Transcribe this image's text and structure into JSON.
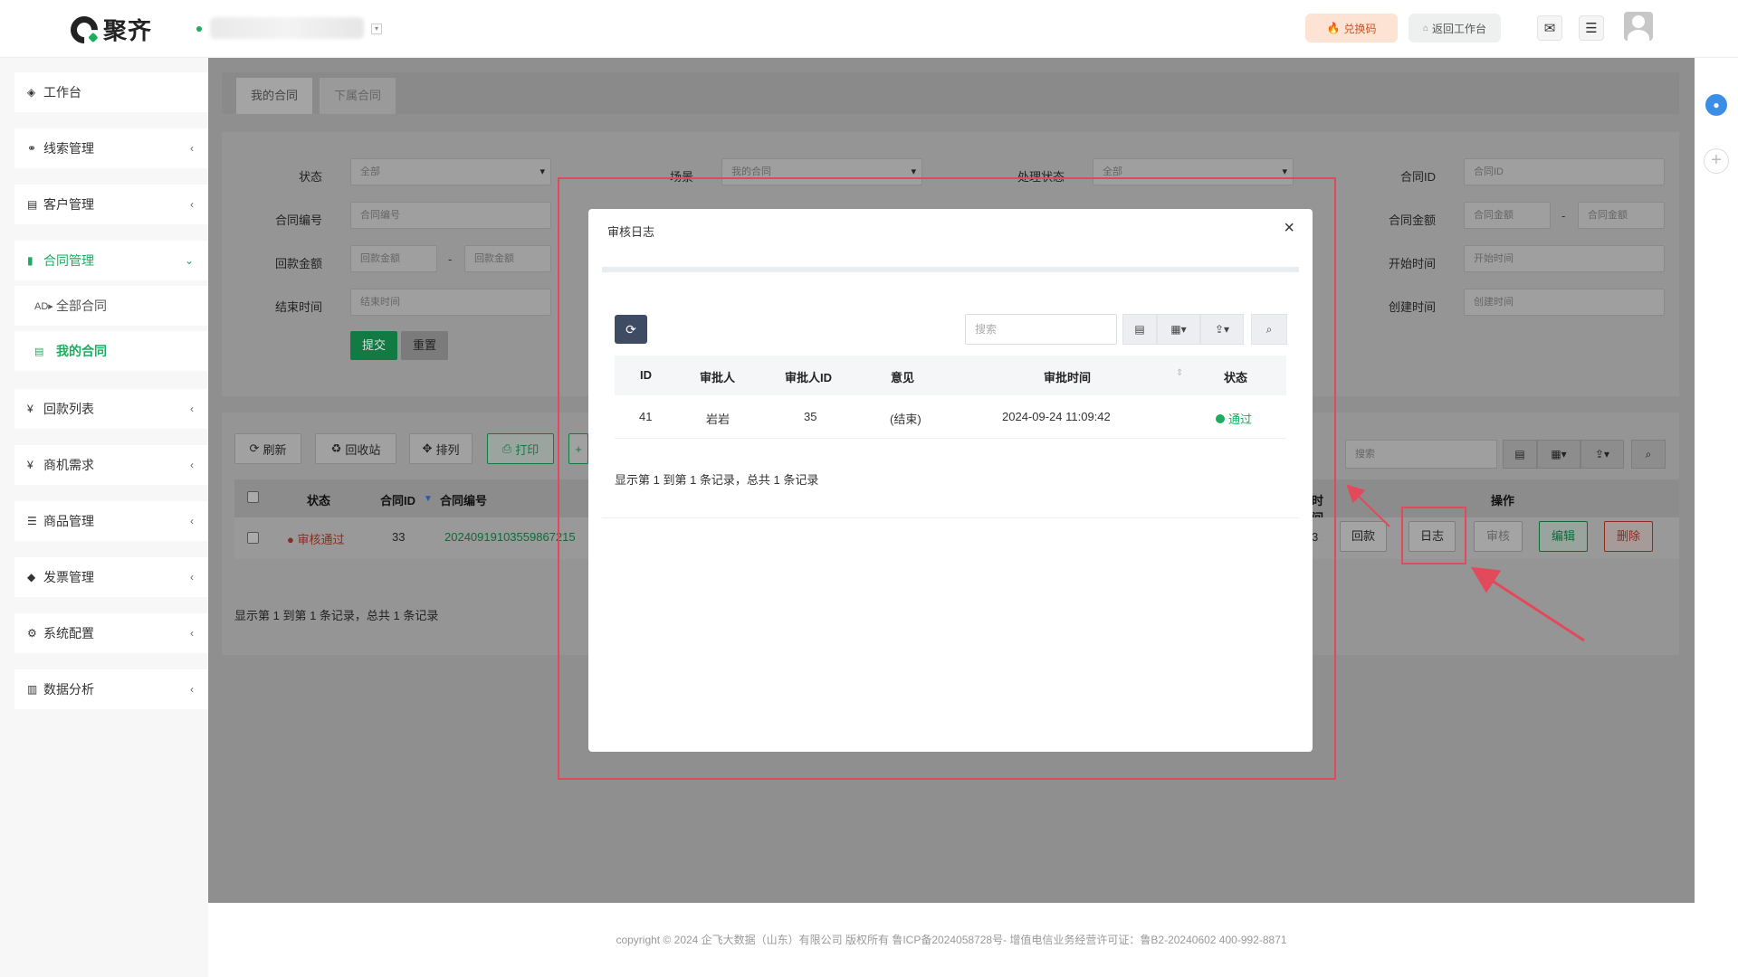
{
  "header": {
    "logo_text": "聚齐",
    "redeem_label": "兑换码",
    "back_label": "返回工作台",
    "mail_icon": "mail-icon",
    "menu_icon": "menu-icon"
  },
  "sidebar": {
    "items": [
      {
        "label": "工作台",
        "icon": "dashboard-icon"
      },
      {
        "label": "线索管理",
        "icon": "link-icon"
      },
      {
        "label": "客户管理",
        "icon": "id-card-icon"
      },
      {
        "label": "合同管理",
        "icon": "bookmark-icon"
      },
      {
        "label": "回款列表",
        "icon": "yen-icon"
      },
      {
        "label": "商机需求",
        "icon": "yen-icon"
      },
      {
        "label": "商品管理",
        "icon": "list-icon"
      },
      {
        "label": "发票管理",
        "icon": "tag-icon"
      },
      {
        "label": "系统配置",
        "icon": "gears-icon"
      },
      {
        "label": "数据分析",
        "icon": "bar-chart-icon"
      }
    ],
    "sub_items": [
      {
        "label": "全部合同",
        "icon": "ad-icon"
      },
      {
        "label": "我的合同",
        "icon": "table-icon"
      }
    ]
  },
  "tabs": [
    "我的合同",
    "下属合同"
  ],
  "filters": {
    "status_label": "状态",
    "status_value": "全部",
    "scene_label": "场景",
    "scene_value": "我的合同",
    "handle_label": "处理状态",
    "handle_value": "全部",
    "contract_id_label": "合同ID",
    "contract_id_placeholder": "合同ID",
    "contract_no_label": "合同编号",
    "contract_no_placeholder": "合同编号",
    "contract_amount_label": "合同金额",
    "contract_amount_placeholder": "合同金额",
    "payment_amount_label": "回款金额",
    "payment_amount_placeholder": "回款金额",
    "start_time_label": "开始时间",
    "start_time_placeholder": "开始时间",
    "end_time_label": "结束时间",
    "end_time_placeholder": "结束时间",
    "create_time_label": "创建时间",
    "create_time_placeholder": "创建时间",
    "dash": "-",
    "submit_label": "提交",
    "reset_label": "重置"
  },
  "toolbar": {
    "refresh_label": "刷新",
    "recycle_label": "回收站",
    "sort_label": "排列",
    "print_label": "打印",
    "plus_label": "+",
    "search_placeholder": "搜索"
  },
  "table": {
    "headers": {
      "status": "状态",
      "contract_id": "合同ID",
      "contract_no": "合同编号",
      "time_partial": "时间",
      "ops": "操作"
    },
    "row": {
      "status": "审核通过",
      "contract_id": "33",
      "contract_no": "20240919103559867215",
      "time_partial": "3 1"
    },
    "ops": {
      "payment": "回款",
      "log": "日志",
      "audit": "审核",
      "edit": "编辑",
      "delete": "删除"
    },
    "footer": "显示第 1 到第 1 条记录，总共 1 条记录"
  },
  "modal": {
    "title": "审核日志",
    "close": "×",
    "search_placeholder": "搜索",
    "columns": [
      "ID",
      "审批人",
      "审批人ID",
      "意见",
      "审批时间",
      "状态"
    ],
    "row": {
      "id": "41",
      "approver": "岩岩",
      "approver_id": "35",
      "opinion": "(结束)",
      "time": "2024-09-24 11:09:42",
      "status": "通过"
    },
    "footer": "显示第 1 到第 1 条记录，总共 1 条记录"
  },
  "footer": {
    "text": "copyright © 2024 企飞大数据（山东）有限公司 版权所有   鲁ICP备2024058728号-   增值电信业务经营许可证：鲁B2-20240602   400-992-8871"
  },
  "colors": {
    "accent": "#1aad5f",
    "annotation": "#e24a5c",
    "danger": "#e0533f"
  }
}
